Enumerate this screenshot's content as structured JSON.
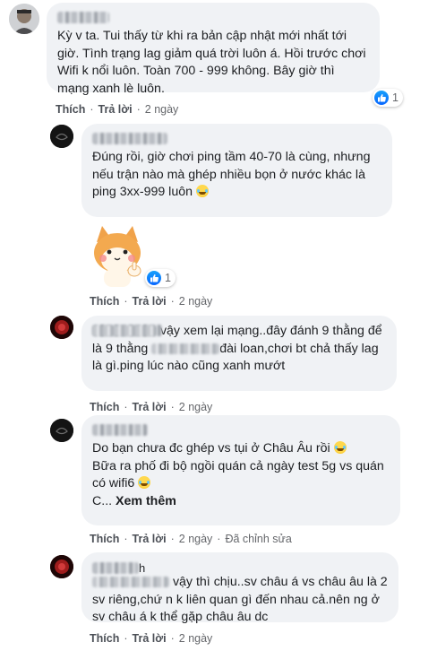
{
  "comments": [
    {
      "text": "Kỳ v ta. Tui thấy từ khi ra bản cập nhật mới nhất tới giờ. Tình trạng lag giảm quá trời luôn á. Hồi trước chơi Wifi k nổi luôn. Toàn 700 - 999 không. Bây giờ thì mạng xanh lè luôn.",
      "reaction_count": "1",
      "like": "Thích",
      "reply": "Trả lời",
      "time": "2 ngày"
    },
    {
      "text": "Đúng rồi, giờ chơi ping tầm 40-70 là cùng, nhưng nếu trận nào mà ghép nhiều bọn ở nước khác là ping 3xx-999 luôn",
      "sticker": "shiba-dog-sticker",
      "reaction_count": "1",
      "like": "Thích",
      "reply": "Trả lời",
      "time": "2 ngày"
    },
    {
      "text_a": "vậy xem lại mạng..đây đánh 9 thằng để là 9 thằng",
      "text_b": "đài loan,chơi bt chả thấy lag là gì.ping lúc nào cũng xanh mướt",
      "like": "Thích",
      "reply": "Trả lời",
      "time": "2 ngày"
    },
    {
      "line1": "Do bạn chưa đc ghép vs tụi ở Châu Âu rồi",
      "line2": "Bữa ra phố đi bộ ngồi quán cả ngày test 5g vs quán có wifi6",
      "line3_prefix": "C...",
      "see_more": "Xem thêm",
      "like": "Thích",
      "reply": "Trả lời",
      "time": "2 ngày",
      "edited": "Đã chỉnh sửa"
    },
    {
      "name_suffix": "h",
      "text": "vậy thì chịu..sv châu á vs châu âu là 2 sv riêng,chứ n k liên quan gì đến nhau cả.nên ng ở sv châu á k thể gặp châu âu dc",
      "like": "Thích",
      "reply": "Trả lời",
      "time": "2 ngày"
    }
  ],
  "colors": {
    "bubble": "#f0f2f5",
    "like_blue": "#0866ff",
    "meta_gray": "#65676b"
  }
}
